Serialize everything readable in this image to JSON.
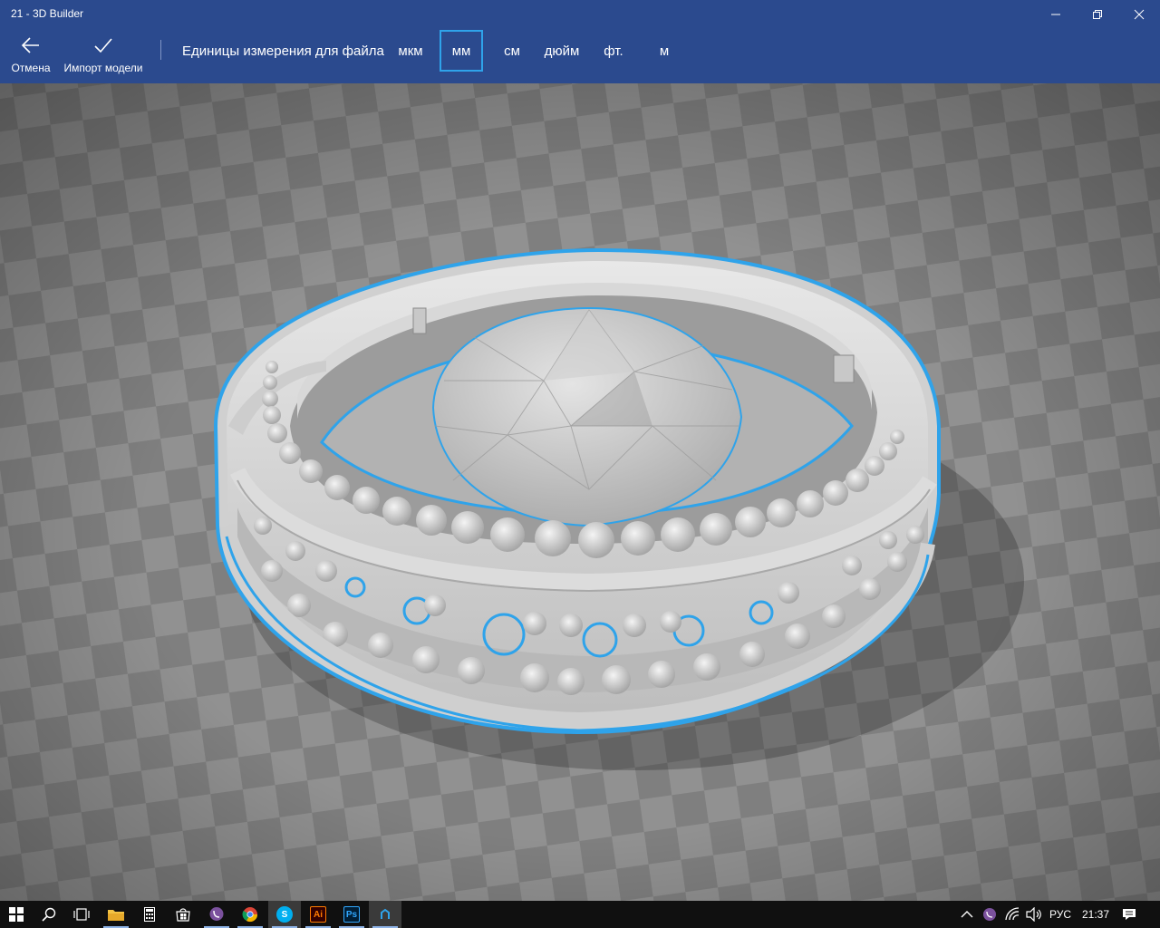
{
  "window": {
    "title": "21 - 3D Builder",
    "controls": [
      "minimize-icon",
      "restore-icon",
      "close-icon"
    ]
  },
  "commandbar": {
    "cancel": {
      "label": "Отмена",
      "icon": "back-arrow-icon"
    },
    "import": {
      "label": "Импорт модели",
      "icon": "checkmark-icon"
    },
    "units_label": "Единицы измерения для файла",
    "units": [
      "мкм",
      "мм",
      "см",
      "дюйм",
      "фт.",
      "м"
    ],
    "selected_unit": "мм",
    "accent_color": "#2fa3ea",
    "bar_color": "#2b4a8e"
  },
  "viewport": {
    "model": "ring",
    "selection_outline_color": "#2fa3ea"
  },
  "taskbar": {
    "icons": [
      "windows-start-icon",
      "search-icon",
      "task-view-icon",
      "file-explorer-icon",
      "calculator-icon",
      "store-icon",
      "viber-icon",
      "chrome-icon",
      "skype-icon",
      "illustrator-icon",
      "photoshop-icon",
      "3d-builder-icon"
    ],
    "tray": {
      "language": "РУС",
      "time": "21:37"
    }
  }
}
